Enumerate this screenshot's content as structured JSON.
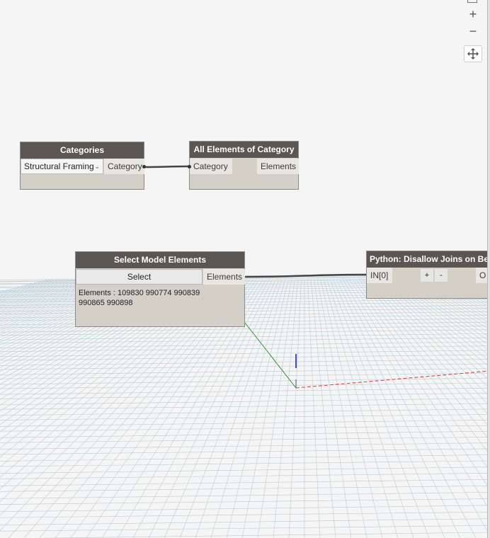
{
  "nodes": {
    "categories": {
      "title": "Categories",
      "dropdown_value": "Structural Framing",
      "output": "Category"
    },
    "all_elements": {
      "title": "All Elements of Category",
      "input": "Category",
      "output": "Elements"
    },
    "select_model": {
      "title": "Select Model Elements",
      "button_label": "Select",
      "output": "Elements",
      "preview_line1": "Elements : 109830 990774 990839",
      "preview_line2": "990865 990898"
    },
    "python": {
      "title": "Python: Disallow Joins on Bea",
      "input": "IN[0]",
      "add_label": "+",
      "remove_label": "-",
      "output": "O"
    }
  },
  "zoom_controls": {
    "zoom_in_label": "+",
    "zoom_out_label": "−"
  },
  "icons": {
    "fit": "fit-view-icon",
    "pan": "pan-icon",
    "dropdown": "chevron-down-icon"
  },
  "colors": {
    "node_header": "#5b5652",
    "node_body": "#d4d0c8",
    "background": "#f5f5f5",
    "grid_line": "#b9ccd6",
    "axis_x": "#d23c3c",
    "axis_y": "#3a8a3a",
    "axis_z": "#3c50c8"
  }
}
